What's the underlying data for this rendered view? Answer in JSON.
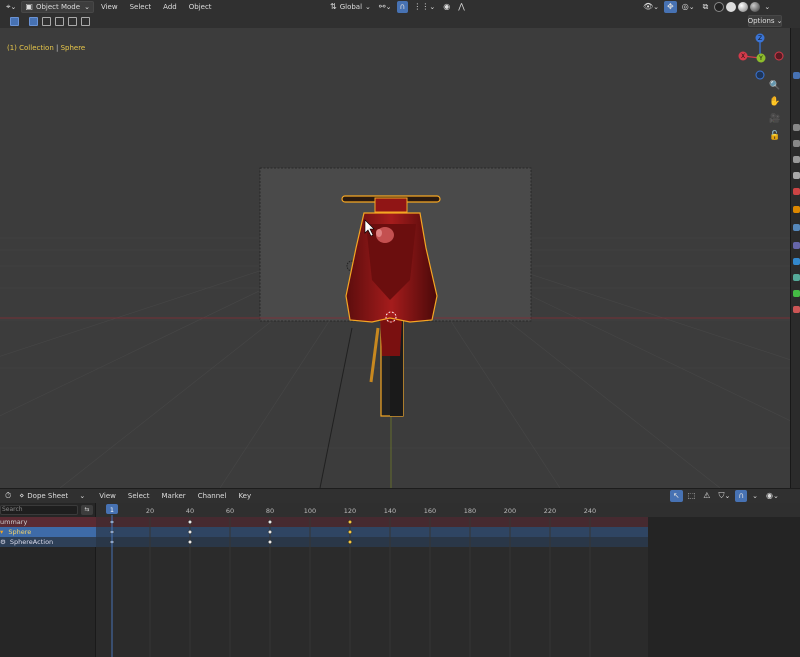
{
  "header": {
    "mode": "Object Mode",
    "menus": [
      "View",
      "Select",
      "Add",
      "Object"
    ],
    "orientation": "Global",
    "options": "Options"
  },
  "viewport": {
    "overlay_collection": "(1) Collection",
    "overlay_object": "Sphere",
    "gizmo_axes": [
      "X",
      "Y",
      "Z"
    ]
  },
  "dopesheet": {
    "editor": "Dope Sheet",
    "menus": [
      "View",
      "Select",
      "Marker",
      "Channel",
      "Key"
    ],
    "search_placeholder": "Search",
    "current_frame": "1",
    "frame_ticks": [
      "20",
      "40",
      "60",
      "80",
      "100",
      "120",
      "140",
      "160",
      "180",
      "200",
      "220",
      "240"
    ],
    "channels": [
      {
        "label": "ummary"
      },
      {
        "label": "Sphere"
      },
      {
        "label": "SphereAction"
      }
    ],
    "keyframes": [
      1,
      40,
      80,
      120
    ]
  },
  "colors": {
    "accent_blue": "#4772b3",
    "selection_orange": "#f5a623",
    "overlay_yellow": "#e8c74a",
    "object_red": "#8a1717"
  }
}
